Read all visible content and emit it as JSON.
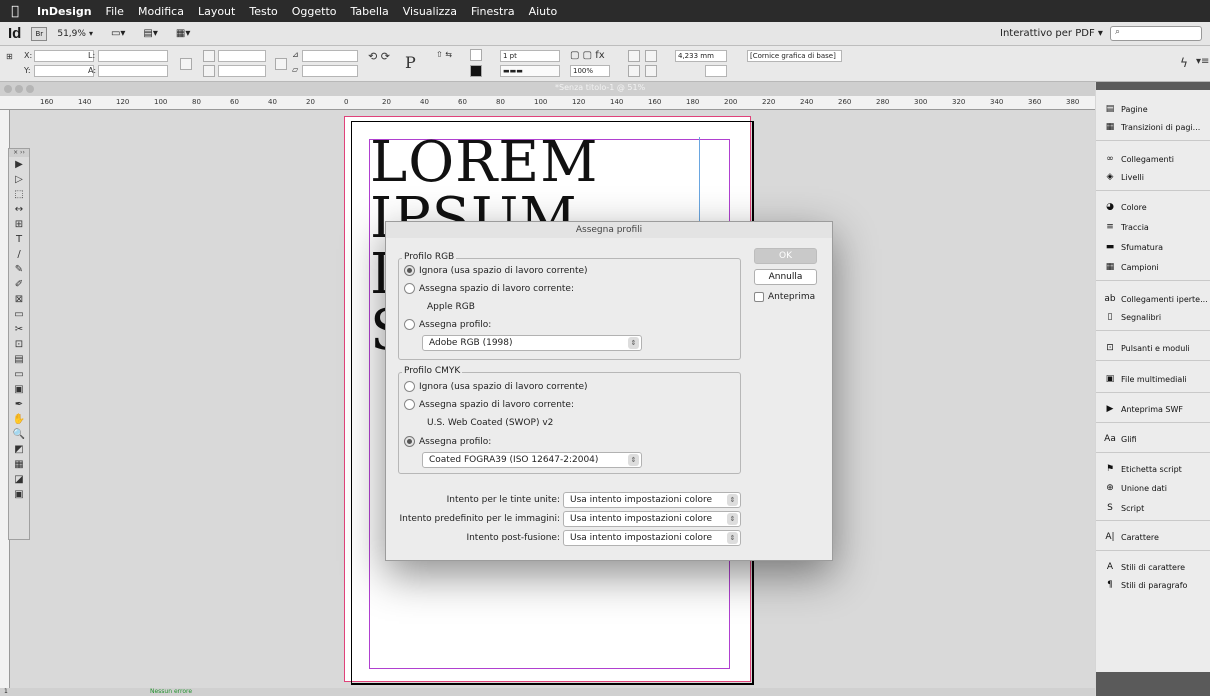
{
  "menubar": {
    "apple": "",
    "app": "InDesign",
    "items": [
      "File",
      "Modifica",
      "Layout",
      "Testo",
      "Oggetto",
      "Tabella",
      "Visualizza",
      "Finestra",
      "Aiuto"
    ]
  },
  "appbar": {
    "logo": "Id",
    "br_label": "Br",
    "zoom": "51,9%",
    "workspace": "Interattivo per PDF",
    "search_placeholder": "⌕"
  },
  "control": {
    "x_label": "X:",
    "y_label": "Y:",
    "l_label": "L:",
    "a_label": "A:",
    "stroke_weight": "1 pt",
    "scale": "100%",
    "size_value": "4,233 mm",
    "frame_style": "[Cornice grafica di base]"
  },
  "document": {
    "tab_title": "*Senza titolo-1 @ 51%",
    "lorem_lines": [
      "LOREM",
      "IPSUM",
      "D",
      "S"
    ]
  },
  "ruler": {
    "labels": [
      "160",
      "140",
      "120",
      "100",
      "80",
      "60",
      "40",
      "20",
      "0",
      "20",
      "40",
      "60",
      "80",
      "100",
      "120",
      "140",
      "160",
      "180",
      "200",
      "220",
      "240",
      "260",
      "280",
      "300",
      "320",
      "340",
      "360",
      "380"
    ]
  },
  "tools": [
    "▶",
    "▷",
    "⬚",
    "↔",
    "⊞",
    "T",
    "/",
    "✎",
    "✐",
    "⊠",
    "▭",
    "✂",
    "⊡",
    "▤",
    "▭",
    "▣",
    "✒",
    "✋",
    "🔍",
    "◩",
    "▦",
    "◪",
    "▣"
  ],
  "panels": {
    "items": [
      {
        "icon": "▤",
        "label": "Pagine"
      },
      {
        "icon": "▦",
        "label": "Transizioni di pagi..."
      },
      {
        "icon": "∞",
        "label": "Collegamenti"
      },
      {
        "icon": "◈",
        "label": "Livelli"
      },
      {
        "icon": "◕",
        "label": "Colore"
      },
      {
        "icon": "≡",
        "label": "Traccia"
      },
      {
        "icon": "▬",
        "label": "Sfumatura"
      },
      {
        "icon": "▦",
        "label": "Campioni"
      },
      {
        "icon": "ab",
        "label": "Collegamenti iperte..."
      },
      {
        "icon": "▯",
        "label": "Segnalibri"
      },
      {
        "icon": "⊡",
        "label": "Pulsanti e moduli"
      },
      {
        "icon": "▣",
        "label": "File multimediali"
      },
      {
        "icon": "▶",
        "label": "Anteprima SWF"
      },
      {
        "icon": "Aa",
        "label": "Glifi"
      },
      {
        "icon": "⚑",
        "label": "Etichetta script"
      },
      {
        "icon": "⊕",
        "label": "Unione dati"
      },
      {
        "icon": "S",
        "label": "Script"
      },
      {
        "icon": "A|",
        "label": "Carattere"
      },
      {
        "icon": "A",
        "label": "Stili di carattere"
      },
      {
        "icon": "¶",
        "label": "Stili di paragrafo"
      }
    ]
  },
  "status": {
    "page": "1",
    "preflight": "Nessun errore"
  },
  "dialog": {
    "title": "Assegna profili",
    "ok": "OK",
    "cancel": "Annulla",
    "preview": "Anteprima",
    "rgb": {
      "label": "Profilo RGB",
      "option_ignore": "Ignora (usa spazio di lavoro corrente)",
      "option_assign_working": "Assegna spazio di lavoro corrente:",
      "working_name": "Apple RGB",
      "option_assign_profile": "Assegna profilo:",
      "profile": "Adobe RGB (1998)",
      "selected": "ignore"
    },
    "cmyk": {
      "label": "Profilo CMYK",
      "option_ignore": "Ignora (usa spazio di lavoro corrente)",
      "option_assign_working": "Assegna spazio di lavoro corrente:",
      "working_name": "U.S. Web Coated (SWOP) v2",
      "option_assign_profile": "Assegna profilo:",
      "profile": "Coated FOGRA39 (ISO 12647-2:2004)",
      "selected": "assign_profile"
    },
    "intents": [
      {
        "label": "Intento per le tinte unite:",
        "value": "Usa intento impostazioni colore"
      },
      {
        "label": "Intento predefinito per le immagini:",
        "value": "Usa intento impostazioni colore"
      },
      {
        "label": "Intento post-fusione:",
        "value": "Usa intento impostazioni colore"
      }
    ]
  }
}
